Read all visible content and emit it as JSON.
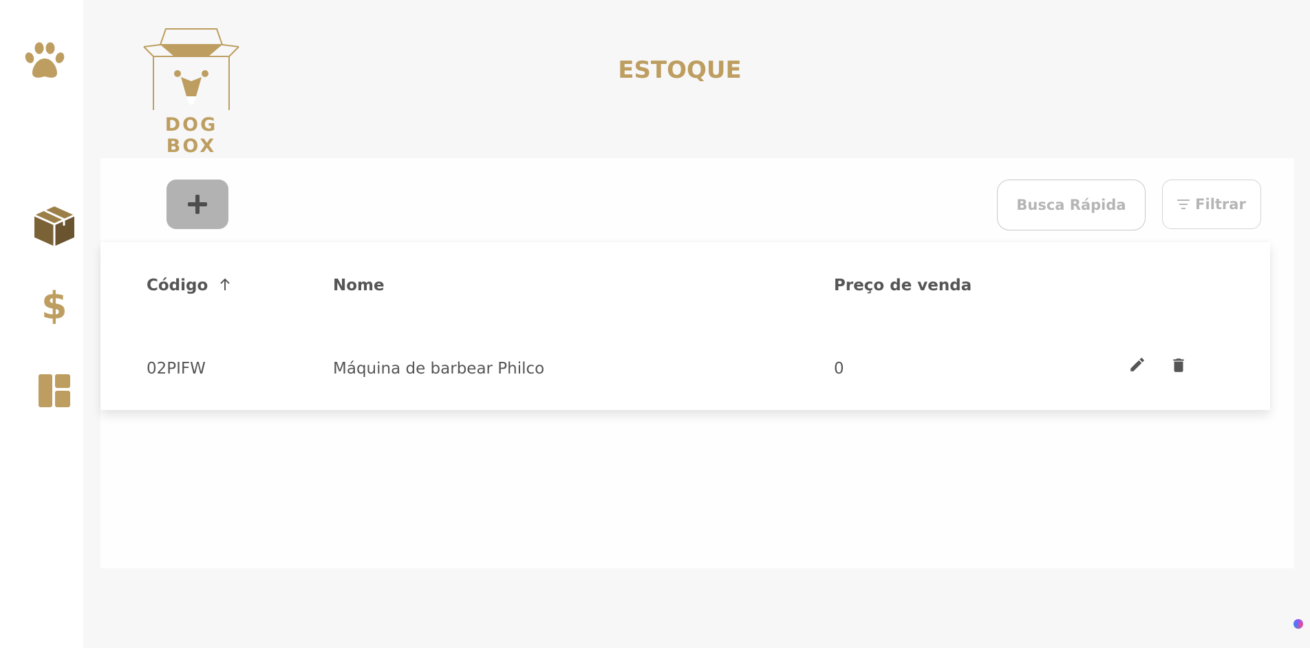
{
  "sidebar": {
    "items": [
      {
        "icon": "paw-icon"
      },
      {
        "icon": "box-icon"
      },
      {
        "icon": "dollar-icon",
        "glyph": "$"
      },
      {
        "icon": "dashboard-icon"
      }
    ]
  },
  "brand": {
    "logo_text": "DOG BOX",
    "color": "#bd9e60"
  },
  "header": {
    "title": "ESTOQUE"
  },
  "toolbar": {
    "add_icon": "plus-icon",
    "search_label": "Busca Rápida",
    "filter_label": "Filtrar"
  },
  "table": {
    "columns": [
      "Código",
      "Nome",
      "Preço de venda"
    ],
    "sort_column": "Código",
    "rows": [
      {
        "codigo": "02PIFW",
        "nome": "Máquina de barbear Philco",
        "preco": "0"
      }
    ]
  },
  "colors": {
    "accent": "#bd9e60",
    "box_icon": "#7a6236",
    "add_button": "#b3b2b3"
  }
}
